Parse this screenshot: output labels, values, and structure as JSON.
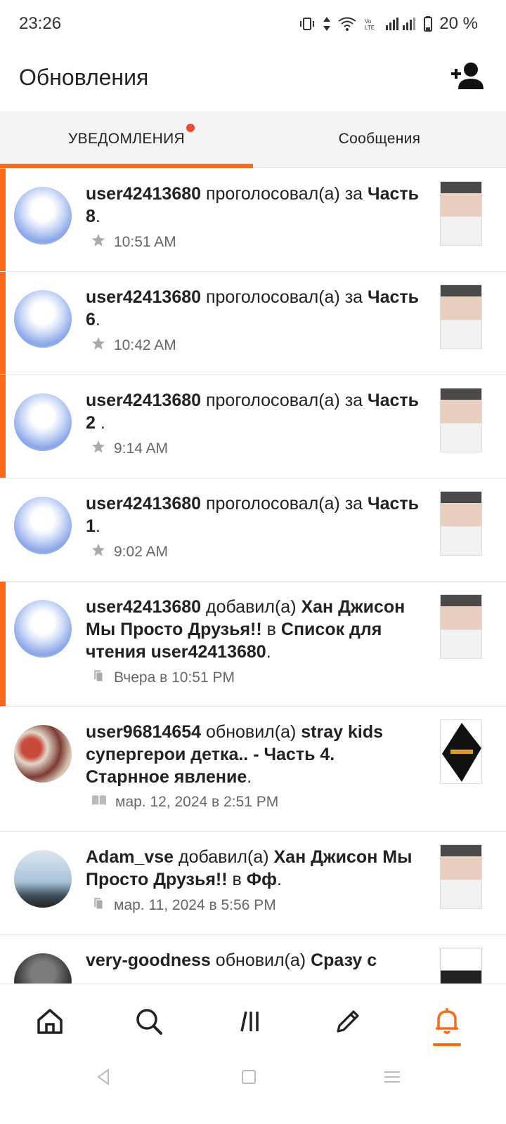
{
  "status": {
    "time": "23:26",
    "battery": "20 %"
  },
  "header": {
    "title": "Обновления"
  },
  "tabs": {
    "updates": "УВЕДОМЛЕНИЯ",
    "messages": "Сообщения"
  },
  "feed": [
    {
      "user": "user42413680",
      "action": " проголосовал(а) за ",
      "target": "Часть 8",
      "tail": ".",
      "time": "10:51 AM",
      "unread": true,
      "icon": "star-icon"
    },
    {
      "user": "user42413680",
      "action": " проголосовал(а) за ",
      "target": "Часть 6",
      "tail": ".",
      "time": "10:42 AM",
      "unread": true,
      "icon": "star-icon"
    },
    {
      "user": "user42413680",
      "action": " проголосовал(а) за ",
      "target": "Часть 2 ",
      "tail": ".",
      "time": "9:14 AM",
      "unread": true,
      "icon": "star-icon"
    },
    {
      "user": "user42413680",
      "action": " проголосовал(а) за ",
      "target": "Часть 1",
      "tail": ".",
      "time": "9:02 AM",
      "unread": false,
      "icon": "star-icon"
    },
    {
      "user": "user42413680",
      "action": " добавил(а) ",
      "target": "Хан Джисон Мы Просто Друзья!!",
      "mid": " в ",
      "target2": "Список для чтения user42413680",
      "tail": ".",
      "time": "Вчера в 10:51 PM",
      "unread": true,
      "icon": "reading-list-icon"
    },
    {
      "user": "user96814654",
      "action": " обновил(а) ",
      "target": "stray kids супергерои детка.. - Часть 4. Старнное явление",
      "tail": ".",
      "time": "мар. 12, 2024 в 2:51 PM",
      "unread": false,
      "icon": "book-icon"
    },
    {
      "user": "Adam_vse",
      "action": " добавил(а) ",
      "target": "Хан Джисон Мы Просто Друзья!!",
      "mid": " в ",
      "target2": "Фф",
      "tail": ".",
      "time": "мар. 11, 2024 в 5:56 PM",
      "unread": false,
      "icon": "reading-list-icon"
    },
    {
      "user": "very-goodness",
      "action": " обновил(а) ",
      "target": "Сразу с",
      "tail": "",
      "time": "",
      "unread": false,
      "icon": "book-icon"
    }
  ],
  "colors": {
    "accent": "#ff6a1a",
    "dot": "#ed4b35"
  }
}
